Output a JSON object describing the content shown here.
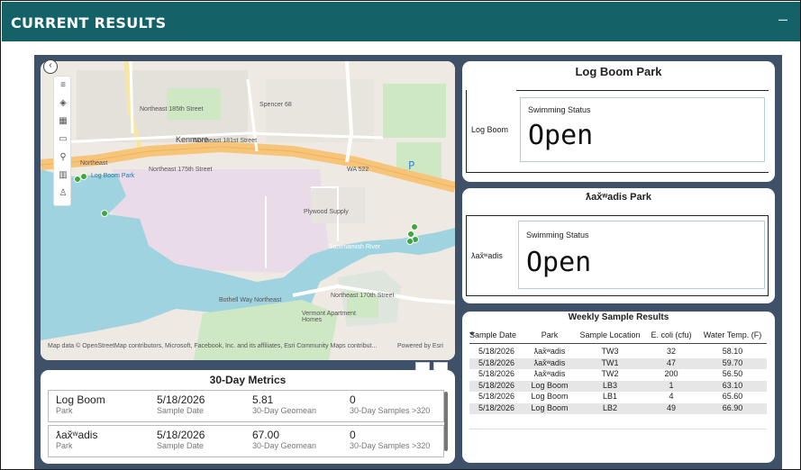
{
  "header": {
    "title": "CURRENT RESULTS",
    "collapse_label": "–"
  },
  "map": {
    "attribution": "Map data © OpenStreetMap contributors, Microsoft, Facebook, Inc. and its affiliates, Esri Community Maps contribut...",
    "powered_by": "Powered by Esri",
    "labels": {
      "kenmore": "Kenmore",
      "log_boom_park": "Log Boom Park",
      "plywood_supply": "Plywood Supply",
      "ne_181st": "Northeast 181st Street",
      "ne_175th": "Northeast 175th Street",
      "wa522": "WA 522",
      "ne_170th": "Northeast 170th Street",
      "northeast": "Northeast",
      "spencer": "Spencer 68",
      "vermont": "Vermont Apartment Homes",
      "sammamish_river": "Sammamish River",
      "ne_185th": "Northeast 185th Street",
      "bothell_way": "Bothell Way Northeast"
    },
    "tools": [
      "list-icon",
      "layers-icon",
      "grid-icon",
      "select-icon",
      "search-icon",
      "chart-icon",
      "person-icon"
    ]
  },
  "status_cards": [
    {
      "park_title": "Log Boom Park",
      "side_label": "Log Boom",
      "status_label": "Swimming Status",
      "status_value": "Open"
    },
    {
      "park_title": "ƛax̌ʷadis Park",
      "side_label": "ƛax̌ʷadis",
      "status_label": "Swimming Status",
      "status_value": "Open"
    }
  ],
  "metrics": {
    "title": "30-Day Metrics",
    "rows": [
      {
        "park": "Log Boom",
        "park_label": "Park",
        "date": "5/18/2026",
        "date_label": "Sample Date",
        "geomean": "5.81",
        "geomean_label": "30-Day Geomean",
        "samples": "0",
        "samples_label": "30-Day Samples >320"
      },
      {
        "park": "ƛax̌ʷadis",
        "park_label": "Park",
        "date": "5/18/2026",
        "date_label": "Sample Date",
        "geomean": "67.00",
        "geomean_label": "30-Day Geomean",
        "samples": "0",
        "samples_label": "30-Day Samples >320"
      }
    ]
  },
  "weekly": {
    "title": "Weekly Sample Results",
    "headers": [
      "Sample Date",
      "Park",
      "Sample Location",
      "E. coli (cfu)",
      "Water Temp. (F)"
    ],
    "rows": [
      [
        "5/18/2026",
        "ƛax̌ʷadis",
        "TW3",
        "32",
        "58.10"
      ],
      [
        "5/18/2026",
        "ƛax̌ʷadis",
        "TW1",
        "47",
        "59.70"
      ],
      [
        "5/18/2026",
        "ƛax̌ʷadis",
        "TW2",
        "200",
        "56.50"
      ],
      [
        "5/18/2026",
        "Log Boom",
        "LB3",
        "1",
        "63.10"
      ],
      [
        "5/18/2026",
        "Log Boom",
        "LB1",
        "4",
        "65.60"
      ],
      [
        "5/18/2026",
        "Log Boom",
        "LB2",
        "49",
        "66.90"
      ]
    ]
  },
  "colors": {
    "header": "#146268",
    "canvas": "#3f5168",
    "water": "#9fd3e0",
    "road_major": "#f6c57a",
    "marker": "#3aa83a"
  }
}
